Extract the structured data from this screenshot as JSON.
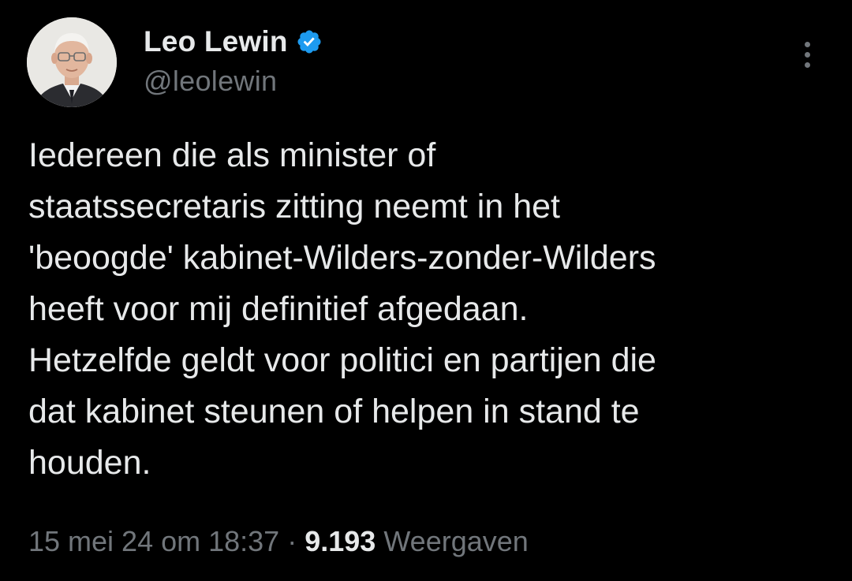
{
  "author": {
    "name": "Leo Lewin",
    "handle": "@leolewin",
    "verified": true,
    "verified_badge_color": "#1d9bf0",
    "avatar_icon": "profile-photo"
  },
  "tweet": {
    "lines": [
      "Iedereen die als minister of",
      "staatssecretaris zitting neemt in het",
      "'beoogde' kabinet-Wilders-zonder-Wilders",
      "heeft voor mij definitief afgedaan.",
      "Hetzelfde geldt voor politici en partijen die",
      "dat kabinet steunen of helpen in stand te",
      "houden."
    ]
  },
  "meta": {
    "timestamp": "15 mei 24 om 18:37",
    "separator": "·",
    "views_count": "9.193",
    "views_label": "Weergaven"
  },
  "colors": {
    "background": "#000000",
    "text": "#e7e9ea",
    "secondary": "#71767b"
  }
}
